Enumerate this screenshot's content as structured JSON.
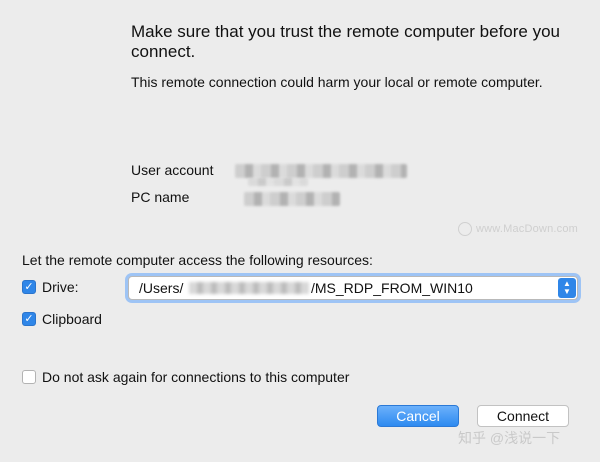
{
  "dialog": {
    "heading": "Make sure that you trust the remote computer before you connect.",
    "subtext": "This remote connection could harm your local or remote computer."
  },
  "info": {
    "user_label": "User account",
    "pc_label": "PC name"
  },
  "watermark": "www.MacDown.com",
  "resources": {
    "label": "Let the remote computer access the following resources:",
    "drive_label": "Drive:",
    "drive_checked": true,
    "clipboard_label": "Clipboard",
    "clipboard_checked": true,
    "path_prefix": "/Users/",
    "path_suffix": "/MS_RDP_FROM_WIN10"
  },
  "dont_ask": {
    "label": "Do not ask again for connections to this computer",
    "checked": false
  },
  "buttons": {
    "cancel": "Cancel",
    "connect": "Connect"
  },
  "footer_watermark": "知乎 @浅说一下",
  "colors": {
    "accent": "#2f86e8",
    "background": "#ececec"
  }
}
